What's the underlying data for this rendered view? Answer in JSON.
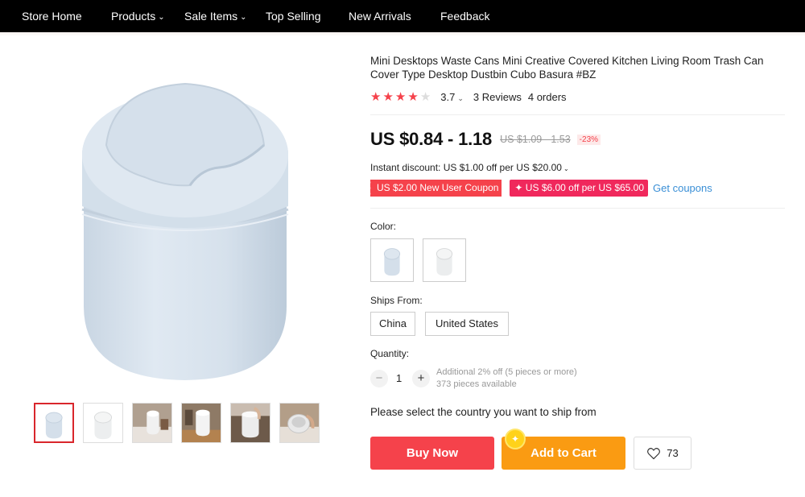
{
  "nav": {
    "items": [
      {
        "label": "Store Home",
        "has_dropdown": false
      },
      {
        "label": "Products",
        "has_dropdown": true
      },
      {
        "label": "Sale Items",
        "has_dropdown": true
      },
      {
        "label": "Top Selling",
        "has_dropdown": false
      },
      {
        "label": "New Arrivals",
        "has_dropdown": false
      },
      {
        "label": "Feedback",
        "has_dropdown": false
      }
    ],
    "dropdown_glyph": "⌄"
  },
  "product": {
    "title": "Mini Desktops Waste Cans Mini Creative Covered Kitchen Living Room Trash Can Cover Type Desktop Dustbin Cubo Basura #BZ",
    "rating": "3.7",
    "stars_filled": 4,
    "stars_total": 5,
    "reviews": "3 Reviews",
    "orders": "4 orders",
    "price": "US $0.84 - 1.18",
    "original_price": "US $1.09 - 1.53",
    "discount": "-23%",
    "instant_discount": "Instant discount: US $1.00 off per US $20.00",
    "coupon_new_user": "US $2.00 New User Coupon",
    "coupon_store": "✦ US $6.00 off per US $65.00",
    "get_coupons": "Get coupons",
    "color_label": "Color:",
    "color_options": [
      "light-blue",
      "white"
    ],
    "ships_from_label": "Ships From:",
    "ships_from_options": [
      "China",
      "United States"
    ],
    "quantity_label": "Quantity:",
    "quantity": "1",
    "quantity_minus": "−",
    "quantity_plus": "+",
    "quantity_note": "Additional 2% off (5 pieces or more)",
    "available": "373 pieces available",
    "ship_note": "Please select the country you want to ship from",
    "buy_now": "Buy Now",
    "add_to_cart": "Add to Cart",
    "cart_badge_icon": "✦",
    "wishlist_count": "73"
  },
  "gallery": {
    "thumbnails": [
      "bin-light-blue",
      "bin-white",
      "bin-photo-desk",
      "bin-photo-kitchen",
      "bin-photo-hand",
      "bin-photo-open-lid"
    ],
    "active_index": 0
  },
  "colors": {
    "nav_bg": "#000000",
    "accent_red": "#f5424b",
    "accent_orange": "#fa9b12",
    "link_blue": "#3a8fd6",
    "product_blue": "#d8e3ee"
  }
}
